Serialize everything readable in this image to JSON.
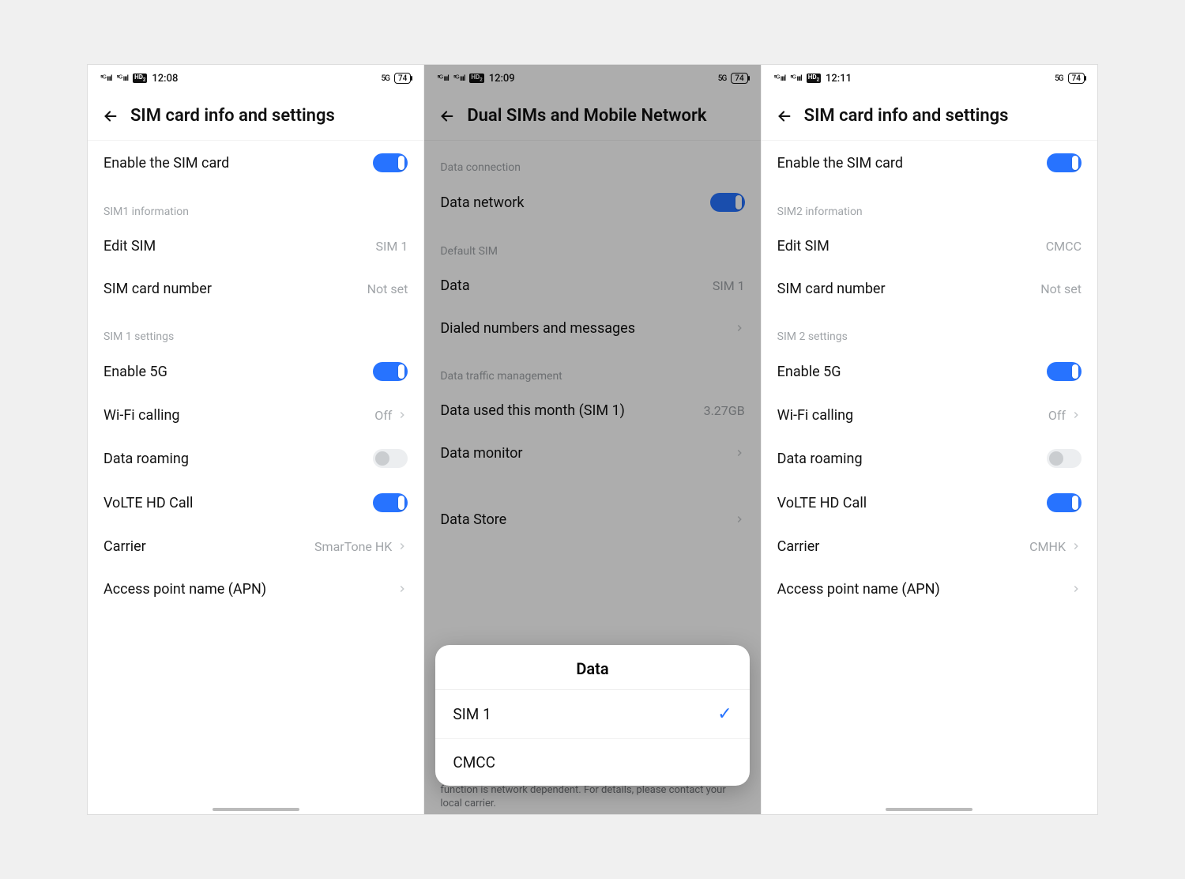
{
  "statusbar": {
    "sig1": "5G",
    "sig2": "5G",
    "hd": "HD",
    "net": "5G",
    "battery": "74"
  },
  "screens": {
    "sim1": {
      "time": "12:08",
      "title": "SIM card info and settings",
      "enable_sim": "Enable the SIM card",
      "section_info": "SIM1 information",
      "edit_sim": "Edit SIM",
      "edit_sim_v": "SIM 1",
      "number": "SIM card number",
      "number_v": "Not set",
      "section_settings": "SIM 1 settings",
      "enable5g": "Enable 5G",
      "wifi_call": "Wi-Fi calling",
      "wifi_call_v": "Off",
      "roaming": "Data roaming",
      "volte": "VoLTE HD Call",
      "carrier": "Carrier",
      "carrier_v": "SmarTone HK",
      "apn": "Access point name (APN)"
    },
    "dual": {
      "time": "12:09",
      "title": "Dual SIMs and Mobile Network",
      "section_conn": "Data connection",
      "data_network": "Data network",
      "section_default": "Default SIM",
      "data": "Data",
      "data_v": "SIM 1",
      "dialed": "Dialed numbers and messages",
      "section_traffic": "Data traffic management",
      "data_used": "Data used this month (SIM 1)",
      "data_used_v": "3.27GB",
      "data_monitor": "Data monitor",
      "data_store": "Data Store",
      "hint": "function is network dependent. For details, please contact your local carrier.",
      "sheet_title": "Data",
      "sheet_opt1": "SIM 1",
      "sheet_opt2": "CMCC"
    },
    "sim2": {
      "time": "12:11",
      "title": "SIM card info and settings",
      "enable_sim": "Enable the SIM card",
      "section_info": "SIM2 information",
      "edit_sim": "Edit SIM",
      "edit_sim_v": "CMCC",
      "number": "SIM card number",
      "number_v": "Not set",
      "section_settings": "SIM 2 settings",
      "enable5g": "Enable 5G",
      "wifi_call": "Wi-Fi calling",
      "wifi_call_v": "Off",
      "roaming": "Data roaming",
      "volte": "VoLTE HD Call",
      "carrier": "Carrier",
      "carrier_v": "CMHK",
      "apn": "Access point name (APN)"
    }
  }
}
